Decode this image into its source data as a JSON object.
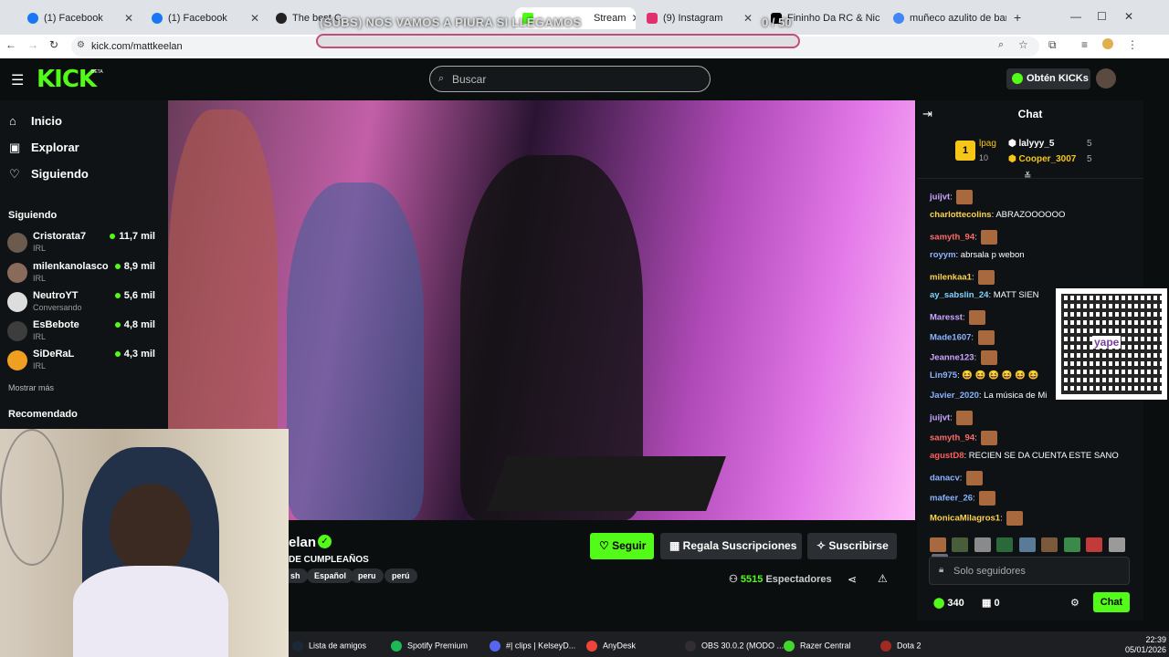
{
  "browser": {
    "tabs": [
      {
        "label": "(1) Facebook",
        "color": "#1877f2"
      },
      {
        "label": "(1) Facebook",
        "color": "#1877f2"
      },
      {
        "label": "The best C",
        "color": "#222"
      },
      {
        "label": "Stream",
        "color": "#53fc18"
      },
      {
        "label": "(9) Instagram",
        "color": "#e1306c"
      },
      {
        "label": "Fininho Da RC & Nic",
        "color": "#000"
      },
      {
        "label": "muñeco azulito de barb",
        "color": "#4285f4"
      }
    ],
    "url": "kick.com/mattkeelan"
  },
  "overlay": {
    "goal_title": "(SUBS) NOS VAMOS A PIURA SI LLEGAMOS",
    "goal_count": "0 / 50"
  },
  "header": {
    "logo": "KICK",
    "logo_badge": "BETA",
    "search_placeholder": "Buscar",
    "get_kicks": "Obtén KICKs"
  },
  "sidebar": {
    "nav": [
      {
        "label": "Inicio",
        "icon": "home-icon"
      },
      {
        "label": "Explorar",
        "icon": "explore-icon"
      },
      {
        "label": "Siguiendo",
        "icon": "heart-icon"
      }
    ],
    "following_title": "Siguiendo",
    "following": [
      {
        "name": "Cristorata7",
        "category": "IRL",
        "viewers": "11,7 mil"
      },
      {
        "name": "milenkanolasco",
        "category": "IRL",
        "viewers": "8,9 mil"
      },
      {
        "name": "NeutroYT",
        "category": "Conversando",
        "viewers": "5,6 mil"
      },
      {
        "name": "EsBebote",
        "category": "IRL",
        "viewers": "4,8 mil"
      },
      {
        "name": "SiDeRaL",
        "category": "IRL",
        "viewers": "4,3 mil"
      }
    ],
    "show_more": "Mostrar más",
    "recommended_title": "Recomendado"
  },
  "stream": {
    "channel_name": "elan",
    "title": "DE CUMPLEAÑOS",
    "tags": [
      "sh",
      "Español",
      "peru",
      "perú"
    ],
    "follow": "Seguir",
    "gift_subs": "Regala Suscripciones",
    "subscribe": "Suscribirse",
    "viewers_count": "5515",
    "viewers_label": "Espectadores"
  },
  "chat": {
    "title": "Chat",
    "leaderboard": {
      "rank": "1",
      "first_name": "lpag",
      "first_count": "10",
      "second_name": "lalyyy_5",
      "second_count": "5",
      "third_name": "Cooper_3007",
      "third_count": "5"
    },
    "messages": [
      {
        "user": "juijvt",
        "text": "",
        "color": "#c9a6ff",
        "emote": true
      },
      {
        "user": "charlottecolins",
        "text": "ABRAZOOOOOO",
        "color": "#ffd34d",
        "emote": false
      },
      {
        "user": "samyth_94",
        "text": "",
        "color": "#ff6b6b",
        "emote": true
      },
      {
        "user": "royym",
        "text": "abrsala p webon",
        "color": "#8ab4ff",
        "emote": false
      },
      {
        "user": "milenkaa1",
        "text": "",
        "color": "#ffd34d",
        "emote": true
      },
      {
        "user": "ay_sabslin_24",
        "text": "MATT SIEN",
        "color": "#7fd3ff",
        "emote": false
      },
      {
        "user": "Maresst",
        "text": "",
        "color": "#c9a6ff",
        "emote": true
      },
      {
        "user": "Made1607",
        "text": "",
        "color": "#8ab4ff",
        "emote": true
      },
      {
        "user": "Jeanne123",
        "text": "",
        "color": "#c9a6ff",
        "emote": true
      },
      {
        "user": "Lin975",
        "text": "😆 😆 😆 😆 😆 😆",
        "color": "#8ab4ff",
        "emote": false
      },
      {
        "user": "Javier_2020",
        "text": "La música de Mi",
        "color": "#8ab4ff",
        "emote": false
      },
      {
        "user": "juijvt",
        "text": "",
        "color": "#c9a6ff",
        "emote": true
      },
      {
        "user": "samyth_94",
        "text": "",
        "color": "#ff6b6b",
        "emote": true
      },
      {
        "user": "agustD8",
        "text": "RECIEN SE DA CUENTA ESTE SANO",
        "color": "#ff5c5c",
        "emote": false
      },
      {
        "user": "danacv",
        "text": "",
        "color": "#8ab4ff",
        "emote": true
      },
      {
        "user": "mafeer_26",
        "text": "",
        "color": "#8ab4ff",
        "emote": true
      },
      {
        "user": "MonicaMilagros1",
        "text": "",
        "color": "#ffd34d",
        "emote": true
      }
    ],
    "qr_label": "yape",
    "input_placeholder": "Solo seguidores",
    "kicks": "340",
    "gifts": "0",
    "send": "Chat"
  },
  "taskbar": {
    "items": [
      {
        "label": "Lista de amigos",
        "color": "#1b2838"
      },
      {
        "label": "Spotify Premium",
        "color": "#1db954"
      },
      {
        "label": "#| clips | KelseyD...",
        "color": "#5865f2"
      },
      {
        "label": "AnyDesk",
        "color": "#ef443b"
      },
      {
        "label": "OBS 30.0.2 (MODO ...",
        "color": "#302e31"
      },
      {
        "label": "Razer Central",
        "color": "#44d62c"
      },
      {
        "label": "Dota 2",
        "color": "#a12a22"
      }
    ],
    "time": "22:39",
    "date": "05/01/2026"
  }
}
